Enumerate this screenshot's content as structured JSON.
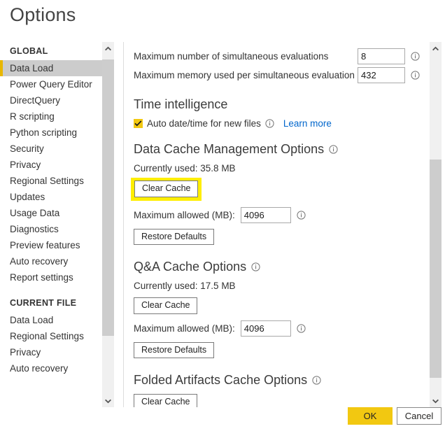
{
  "dialog": {
    "title": "Options"
  },
  "sidebar": {
    "groups": [
      {
        "header": "GLOBAL",
        "items": [
          {
            "label": "Data Load",
            "selected": true
          },
          {
            "label": "Power Query Editor",
            "selected": false
          },
          {
            "label": "DirectQuery",
            "selected": false
          },
          {
            "label": "R scripting",
            "selected": false
          },
          {
            "label": "Python scripting",
            "selected": false
          },
          {
            "label": "Security",
            "selected": false
          },
          {
            "label": "Privacy",
            "selected": false
          },
          {
            "label": "Regional Settings",
            "selected": false
          },
          {
            "label": "Updates",
            "selected": false
          },
          {
            "label": "Usage Data",
            "selected": false
          },
          {
            "label": "Diagnostics",
            "selected": false
          },
          {
            "label": "Preview features",
            "selected": false
          },
          {
            "label": "Auto recovery",
            "selected": false
          },
          {
            "label": "Report settings",
            "selected": false
          }
        ]
      },
      {
        "header": "CURRENT FILE",
        "items": [
          {
            "label": "Data Load",
            "selected": false
          },
          {
            "label": "Regional Settings",
            "selected": false
          },
          {
            "label": "Privacy",
            "selected": false
          },
          {
            "label": "Auto recovery",
            "selected": false
          }
        ]
      }
    ],
    "scroll_up_icon": "chevron-up-icon",
    "scroll_down_icon": "chevron-down-icon"
  },
  "content": {
    "parallel_loading": {
      "max_evaluations_label": "Maximum number of simultaneous evaluations",
      "max_evaluations_value": "8",
      "max_memory_label": "Maximum memory used per simultaneous evaluation (MB)",
      "max_memory_value": "432",
      "info_icon": "info-icon"
    },
    "time_intelligence": {
      "heading": "Time intelligence",
      "checkbox_label": "Auto date/time for new files",
      "checkbox_checked": true,
      "learn_more": "Learn more",
      "info_icon": "info-icon"
    },
    "data_cache": {
      "heading": "Data Cache Management Options",
      "currently_used": "Currently used: 35.8 MB",
      "clear_cache_label": "Clear Cache",
      "clear_cache_highlighted": true,
      "max_allowed_label": "Maximum allowed (MB):",
      "max_allowed_value": "4096",
      "restore_defaults_label": "Restore Defaults",
      "info_icon": "info-icon"
    },
    "qna_cache": {
      "heading": "Q&A Cache Options",
      "currently_used": "Currently used: 17.5 MB",
      "clear_cache_label": "Clear Cache",
      "max_allowed_label": "Maximum allowed (MB):",
      "max_allowed_value": "4096",
      "restore_defaults_label": "Restore Defaults",
      "info_icon": "info-icon"
    },
    "folded_artifacts_cache": {
      "heading": "Folded Artifacts Cache Options",
      "clear_cache_label": "Clear Cache",
      "info_icon": "info-icon"
    },
    "scroll_up_icon": "chevron-up-icon",
    "scroll_down_icon": "chevron-down-icon"
  },
  "footer": {
    "ok_label": "OK",
    "cancel_label": "Cancel"
  },
  "colors": {
    "accent_yellow": "#f2c811",
    "highlight_yellow": "#ffee00",
    "link_blue": "#0066cc",
    "selected_gray": "#cccccc",
    "scrollbar_thumb": "#cdcdcd"
  }
}
